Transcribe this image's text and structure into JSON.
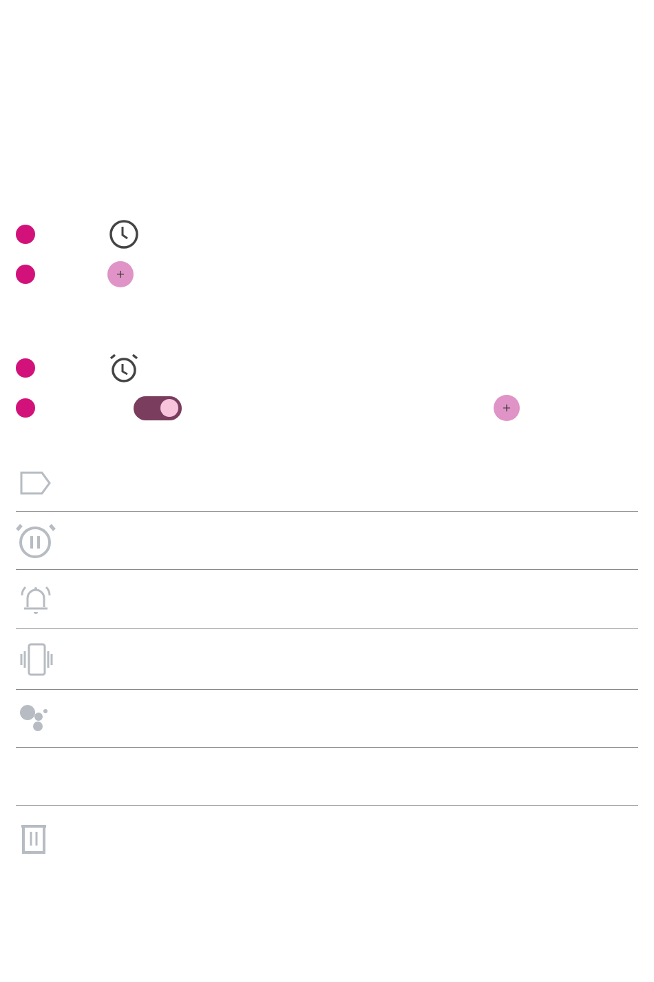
{
  "header_rows": [
    {
      "kind": "clock"
    },
    {
      "kind": "add"
    },
    {
      "kind": "spacer"
    },
    {
      "kind": "alarm"
    },
    {
      "kind": "switch_add"
    }
  ],
  "alarm_switch": {
    "on": true
  },
  "settings_rows": [
    {
      "kind": "label"
    },
    {
      "kind": "snooze"
    },
    {
      "kind": "ringtone"
    },
    {
      "kind": "vibrate"
    },
    {
      "kind": "assistant"
    },
    {
      "kind": "empty"
    },
    {
      "kind": "delete"
    }
  ]
}
